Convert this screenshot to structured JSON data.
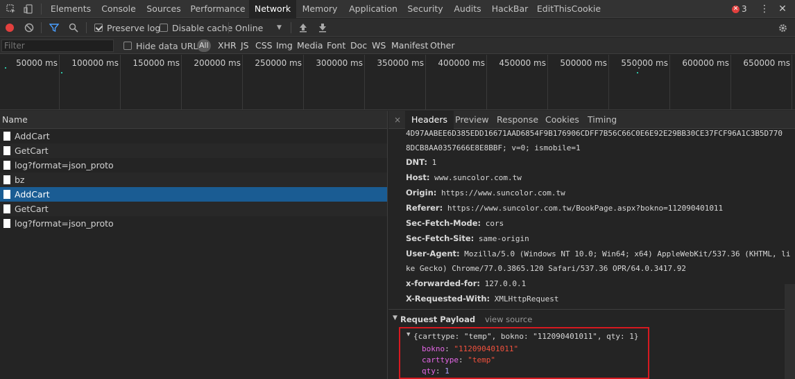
{
  "tabs": [
    "Elements",
    "Console",
    "Sources",
    "Performance",
    "Network",
    "Memory",
    "Application",
    "Security",
    "Audits",
    "HackBar",
    "EditThisCookie"
  ],
  "active_tab": "Network",
  "errors_count": "3",
  "toolbar": {
    "preserve_log": "Preserve log",
    "disable_cache": "Disable cache",
    "throttling": "Online"
  },
  "filter": {
    "placeholder": "Filter",
    "hide_data_urls": "Hide data URLs",
    "types": [
      "All",
      "XHR",
      "JS",
      "CSS",
      "Img",
      "Media",
      "Font",
      "Doc",
      "WS",
      "Manifest",
      "Other"
    ]
  },
  "timeline": {
    "ticks": [
      "50000 ms",
      "100000 ms",
      "150000 ms",
      "200000 ms",
      "250000 ms",
      "300000 ms",
      "350000 ms",
      "400000 ms",
      "450000 ms",
      "500000 ms",
      "550000 ms",
      "600000 ms",
      "650000 ms"
    ]
  },
  "requests": {
    "header": "Name",
    "items": [
      "AddCart",
      "GetCart",
      "log?format=json_proto",
      "bz",
      "AddCart",
      "GetCart",
      "log?format=json_proto"
    ],
    "selected_index": 4
  },
  "detail": {
    "close": "×",
    "tabs": [
      "Headers",
      "Preview",
      "Response",
      "Cookies",
      "Timing"
    ],
    "active_tab": "Headers",
    "header_lines": [
      {
        "name": "",
        "value": "4D97AABEE6D385EDD16671AAD6854F9B176906CDFF7B56C66C0E6E92E29BB30CE37FCF96A1C3B5D770"
      },
      {
        "name": "",
        "value": "8DCB8AA0357666E8E8BBF; v=0; ismobile=1"
      },
      {
        "name": "DNT:",
        "value": "1"
      },
      {
        "name": "Host:",
        "value": "www.suncolor.com.tw"
      },
      {
        "name": "Origin:",
        "value": "https://www.suncolor.com.tw"
      },
      {
        "name": "Referer:",
        "value": "https://www.suncolor.com.tw/BookPage.aspx?bokno=112090401011"
      },
      {
        "name": "Sec-Fetch-Mode:",
        "value": "cors"
      },
      {
        "name": "Sec-Fetch-Site:",
        "value": "same-origin"
      },
      {
        "name": "User-Agent:",
        "value": "Mozilla/5.0 (Windows NT 10.0; Win64; x64) AppleWebKit/537.36 (KHTML, li"
      },
      {
        "name": "",
        "value": "ke Gecko) Chrome/77.0.3865.120 Safari/537.36 OPR/64.0.3417.92"
      },
      {
        "name": "x-forwarded-for:",
        "value": "127.0.0.1"
      },
      {
        "name": "X-Requested-With:",
        "value": "XMLHttpRequest"
      }
    ],
    "payload": {
      "title": "Request Payload",
      "view_source": "view source",
      "summary": "{carttype: \"temp\", bokno: \"112090401011\", qty: 1}",
      "fields": [
        {
          "key": "bokno",
          "value": "\"112090401011\"",
          "type": "string"
        },
        {
          "key": "carttype",
          "value": "\"temp\"",
          "type": "string"
        },
        {
          "key": "qty",
          "value": "1",
          "type": "number"
        }
      ]
    }
  }
}
